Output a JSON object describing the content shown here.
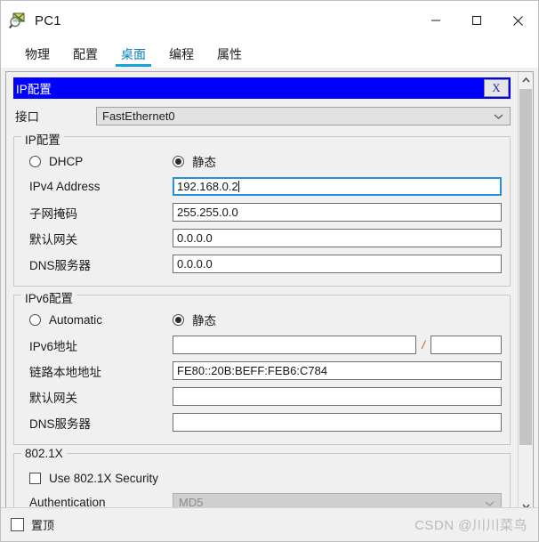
{
  "window": {
    "title": "PC1",
    "icon": "packet-tracer-icon",
    "minimize_label": "—",
    "maximize_label": "□",
    "close_label": "✕"
  },
  "tabs": [
    {
      "label": "物理",
      "active": false
    },
    {
      "label": "配置",
      "active": false
    },
    {
      "label": "桌面",
      "active": true
    },
    {
      "label": "编程",
      "active": false
    },
    {
      "label": "属性",
      "active": false
    }
  ],
  "ip_panel": {
    "header_title": "IP配置",
    "close_button_label": "X",
    "interface": {
      "label": "接口",
      "value": "FastEthernet0"
    },
    "ipv4": {
      "legend": "IP配置",
      "dhcp_label": "DHCP",
      "dhcp_checked": false,
      "static_label": "静态",
      "static_checked": true,
      "fields": [
        {
          "label": "IPv4 Address",
          "value": "192.168.0.2",
          "focused": true
        },
        {
          "label": "子网掩码",
          "value": "255.255.0.0",
          "focused": false
        },
        {
          "label": "默认网关",
          "value": "0.0.0.0",
          "focused": false
        },
        {
          "label": "DNS服务器",
          "value": "0.0.0.0",
          "focused": false
        }
      ]
    },
    "ipv6": {
      "legend": "IPv6配置",
      "automatic_label": "Automatic",
      "automatic_checked": false,
      "static_label": "静态",
      "static_checked": true,
      "address_label": "IPv6地址",
      "address_value": "",
      "prefix_separator": "/",
      "prefix_value": "",
      "fields": [
        {
          "label": "链路本地地址",
          "value": "FE80::20B:BEFF:FEB6:C784"
        },
        {
          "label": "默认网关",
          "value": ""
        },
        {
          "label": "DNS服务器",
          "value": ""
        }
      ]
    },
    "dot1x": {
      "legend": "802.1X",
      "use_security_label": "Use 802.1X Security",
      "use_security_checked": false,
      "authentication_label": "Authentication",
      "authentication_value": "MD5"
    }
  },
  "bottom": {
    "always_on_top_label": "置顶",
    "always_on_top_checked": false,
    "watermark": "CSDN @川川菜鸟"
  },
  "colors": {
    "header_blue": "#0000ff",
    "tab_active": "#19a3dd",
    "focus_border": "#2b8fd8"
  }
}
